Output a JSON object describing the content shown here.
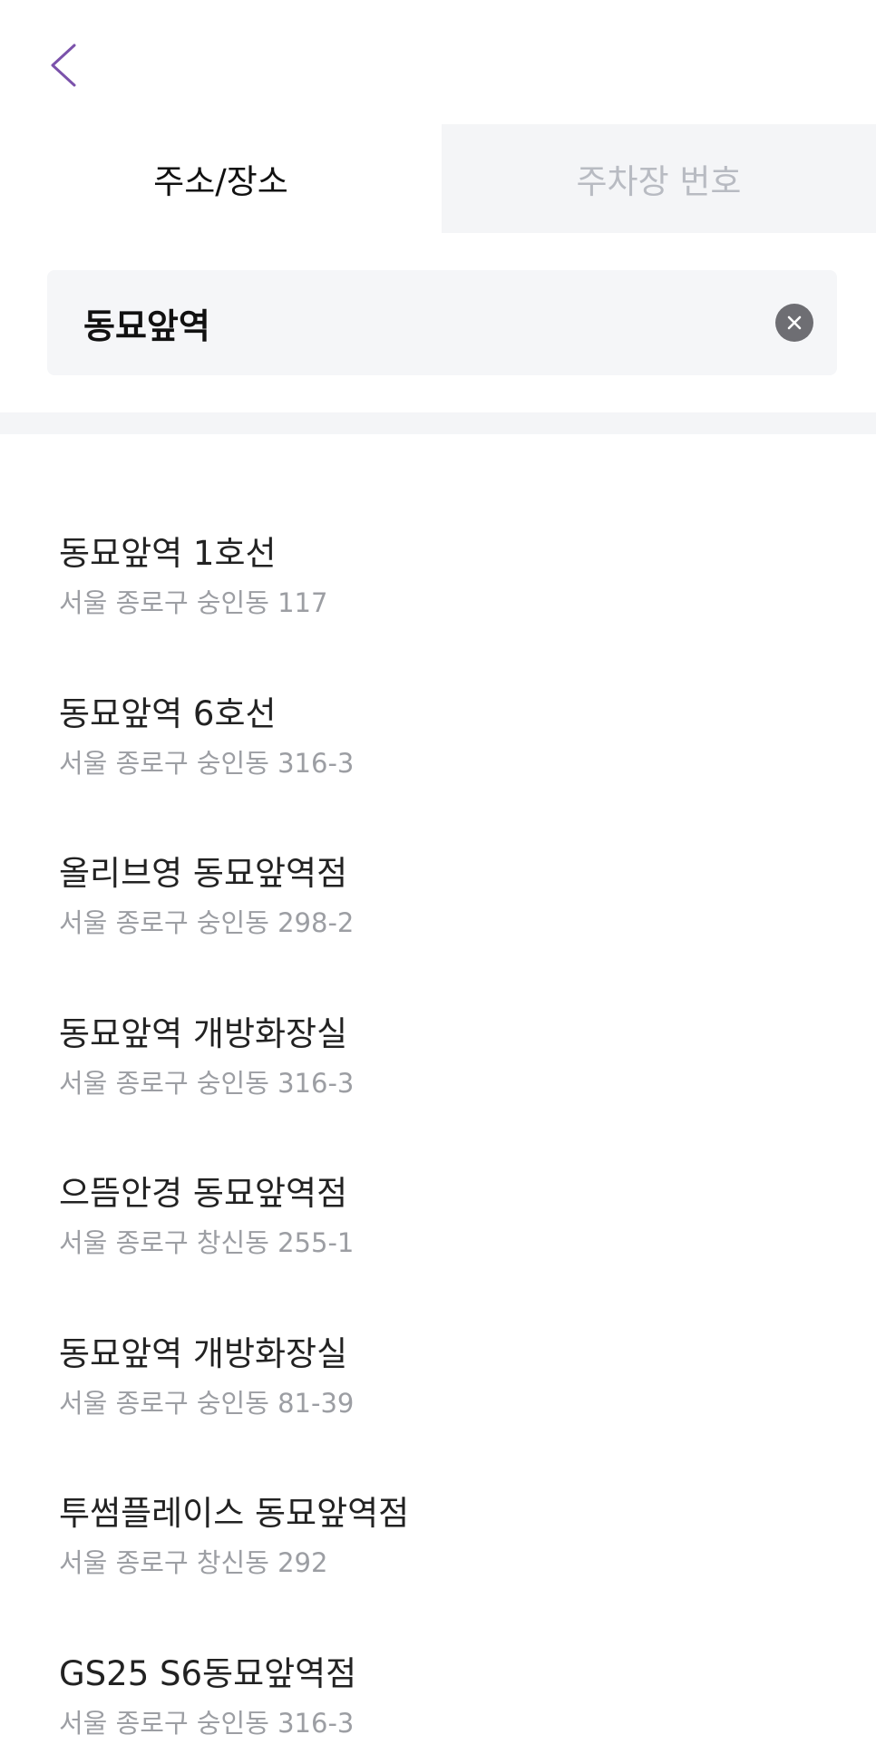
{
  "header": {
    "back_icon": "chevron-left-icon",
    "accent_color": "#7b52ab"
  },
  "tabs": [
    {
      "label": "주소/장소",
      "active": true
    },
    {
      "label": "주차장 번호",
      "active": false
    }
  ],
  "search": {
    "value": "동묘앞역",
    "clear_icon": "clear-circle-icon"
  },
  "results": [
    {
      "name": "동묘앞역 1호선",
      "address": "서울 종로구 숭인동 117"
    },
    {
      "name": "동묘앞역 6호선",
      "address": "서울 종로구 숭인동 316-3"
    },
    {
      "name": "올리브영 동묘앞역점",
      "address": "서울 종로구 숭인동 298-2"
    },
    {
      "name": "동묘앞역 개방화장실",
      "address": "서울 종로구 숭인동 316-3"
    },
    {
      "name": "으뜸안경 동묘앞역점",
      "address": "서울 종로구 창신동 255-1"
    },
    {
      "name": "동묘앞역 개방화장실",
      "address": "서울 종로구 숭인동 81-39"
    },
    {
      "name": "투썸플레이스 동묘앞역점",
      "address": "서울 종로구 창신동 292"
    },
    {
      "name": "GS25 S6동묘앞역점",
      "address": "서울 종로구 숭인동 316-3"
    }
  ]
}
